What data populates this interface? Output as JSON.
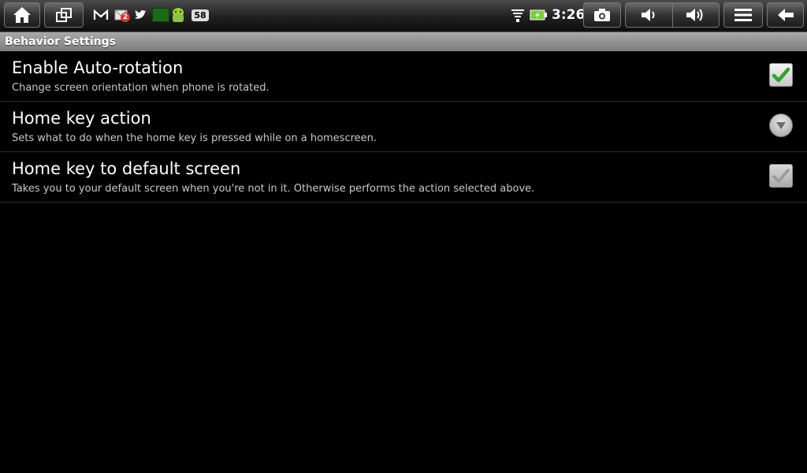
{
  "statusbar": {
    "home_icon": "home-icon",
    "recent_icon": "recent-apps-icon",
    "notifications": [
      {
        "name": "gmail-icon"
      },
      {
        "name": "mail-icon",
        "badge": "2"
      },
      {
        "name": "twitter-icon"
      },
      {
        "name": "battery-bar-icon"
      },
      {
        "name": "android-icon"
      }
    ],
    "notification_count": "58",
    "clock": "3:26",
    "buttons": [
      "camera-icon",
      "volume-down-icon",
      "volume-up-icon",
      "menu-icon",
      "back-icon"
    ]
  },
  "header": {
    "title": "Behavior Settings"
  },
  "settings": [
    {
      "title": "Enable Auto-rotation",
      "summary": "Change screen orientation when phone is rotated.",
      "control": "checkbox",
      "checked": true,
      "enabled": true
    },
    {
      "title": "Home key action",
      "summary": "Sets what to do when the home key is pressed while on a homescreen.",
      "control": "dropdown"
    },
    {
      "title": "Home key to default screen",
      "summary": "Takes you to your default screen when you're not in it. Otherwise performs the action selected above.",
      "control": "checkbox",
      "checked": true,
      "enabled": false
    }
  ],
  "colors": {
    "check_green": "#2fa52f",
    "check_disabled": "#9a9a9a",
    "header_bg": "#8f8f8f"
  }
}
